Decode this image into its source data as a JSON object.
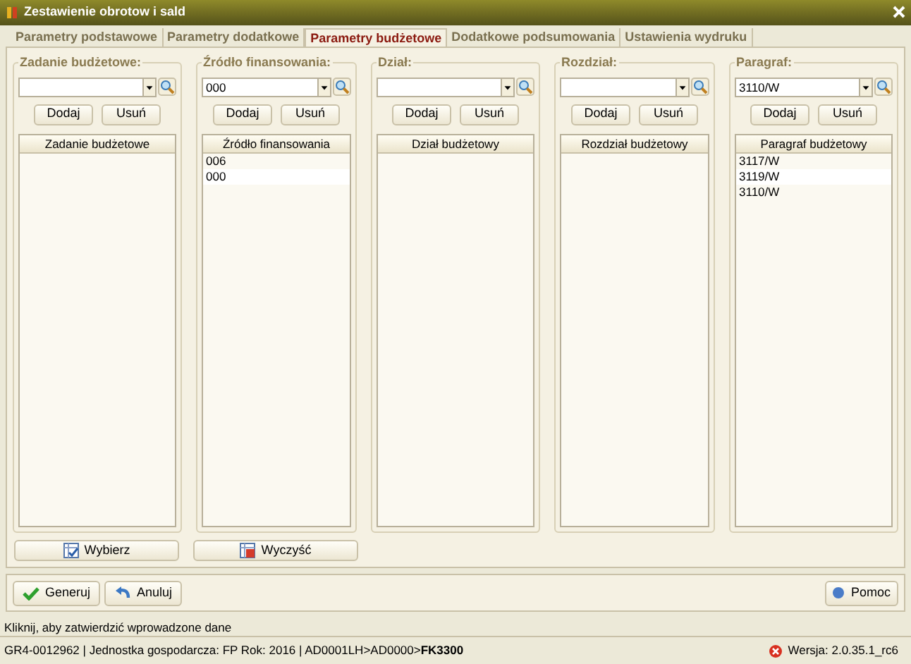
{
  "window": {
    "title": "Zestawienie obrotow i sald"
  },
  "tabs": [
    {
      "label": "Parametry podstawowe",
      "selected": false
    },
    {
      "label": "Parametry dodatkowe",
      "selected": false
    },
    {
      "label": "Parametry budżetowe",
      "selected": true
    },
    {
      "label": "Dodatkowe podsumowania",
      "selected": false
    },
    {
      "label": "Ustawienia wydruku",
      "selected": false
    }
  ],
  "groups": [
    {
      "label": "Zadanie budżetowe:",
      "add_button": "Dodaj",
      "remove_button": "Usuń",
      "column": "Zadanie budżetowe"
    },
    {
      "label": "Źródło finansowania:",
      "value": "000",
      "add_button": "Dodaj",
      "remove_button": "Usuń",
      "column": "Źródło finansowania",
      "rows": [
        "006",
        "000"
      ]
    },
    {
      "label": "Dział:",
      "add_button": "Dodaj",
      "remove_button": "Usuń",
      "column": "Dział budżetowy"
    },
    {
      "label": "Rozdział:",
      "add_button": "Dodaj",
      "remove_button": "Usuń",
      "column": "Rozdział budżetowy"
    },
    {
      "label": "Paragraf:",
      "value": "3110/W",
      "add_button": "Dodaj",
      "remove_button": "Usuń",
      "column": "Paragraf budżetowy",
      "rows": [
        "3117/W",
        "3119/W",
        "3110/W"
      ]
    }
  ],
  "select_buttons": [
    {
      "label": "Wybierz",
      "kind": "select"
    },
    {
      "label": "Wyczyść",
      "kind": "clear"
    }
  ],
  "actions": [
    {
      "label": "Generuj",
      "kind": "ok"
    },
    {
      "label": "Anuluj",
      "kind": "cancel"
    }
  ],
  "help_button": "Pomoc",
  "hint": "Kliknij, aby zatwierdzić wprowadzone dane",
  "status_bar": {
    "info": "GR4-0012962 | Jednostka gospodarcza: FP Rok: 2016 | AD0001LH>AD0000>**FK3300**",
    "version": "Wersja: 2.0.35.1_rc6"
  }
}
